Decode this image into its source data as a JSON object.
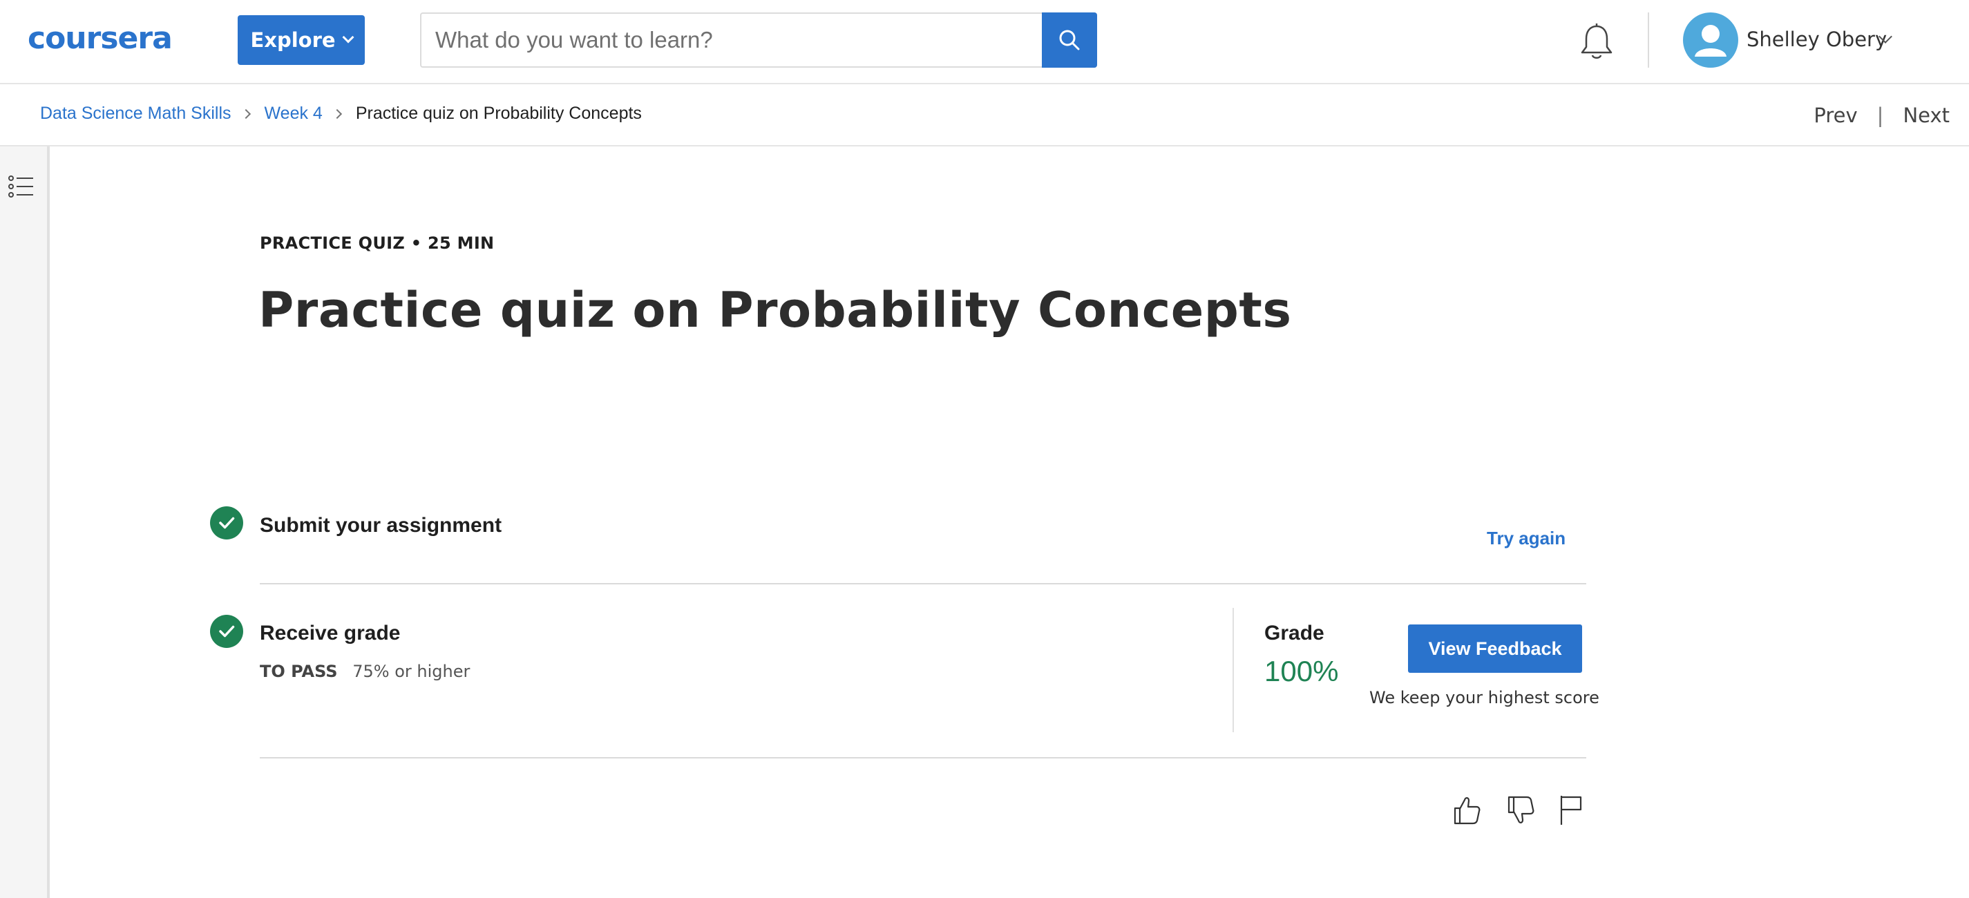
{
  "header": {
    "logo_text": "coursera",
    "explore_label": "Explore",
    "search_placeholder": "What do you want to learn?",
    "user_name": "Shelley Obery"
  },
  "breadcrumb": {
    "items": [
      "Data Science Math Skills",
      "Week 4"
    ],
    "current": "Practice quiz on Probability Concepts"
  },
  "nav": {
    "prev_label": "Prev",
    "separator": "|",
    "next_label": "Next"
  },
  "quiz": {
    "kicker": "PRACTICE QUIZ • 25 MIN",
    "title": "Practice quiz on Probability Concepts",
    "step1": {
      "label": "Submit your assignment",
      "action": "Try again"
    },
    "step2": {
      "label": "Receive grade",
      "pass_label": "TO PASS",
      "pass_value": "75% or higher",
      "grade_label": "Grade",
      "grade_value": "100%",
      "feedback_button": "View Feedback",
      "note": "We keep your highest score"
    }
  },
  "colors": {
    "brand_blue": "#2a73cc",
    "success_green": "#1f8354",
    "avatar_blue": "#4fa9dc"
  },
  "icons": [
    "search-icon",
    "bell-icon",
    "user-avatar-icon",
    "table-of-contents-icon",
    "check-icon",
    "thumbs-up-icon",
    "thumbs-down-icon",
    "flag-icon"
  ]
}
